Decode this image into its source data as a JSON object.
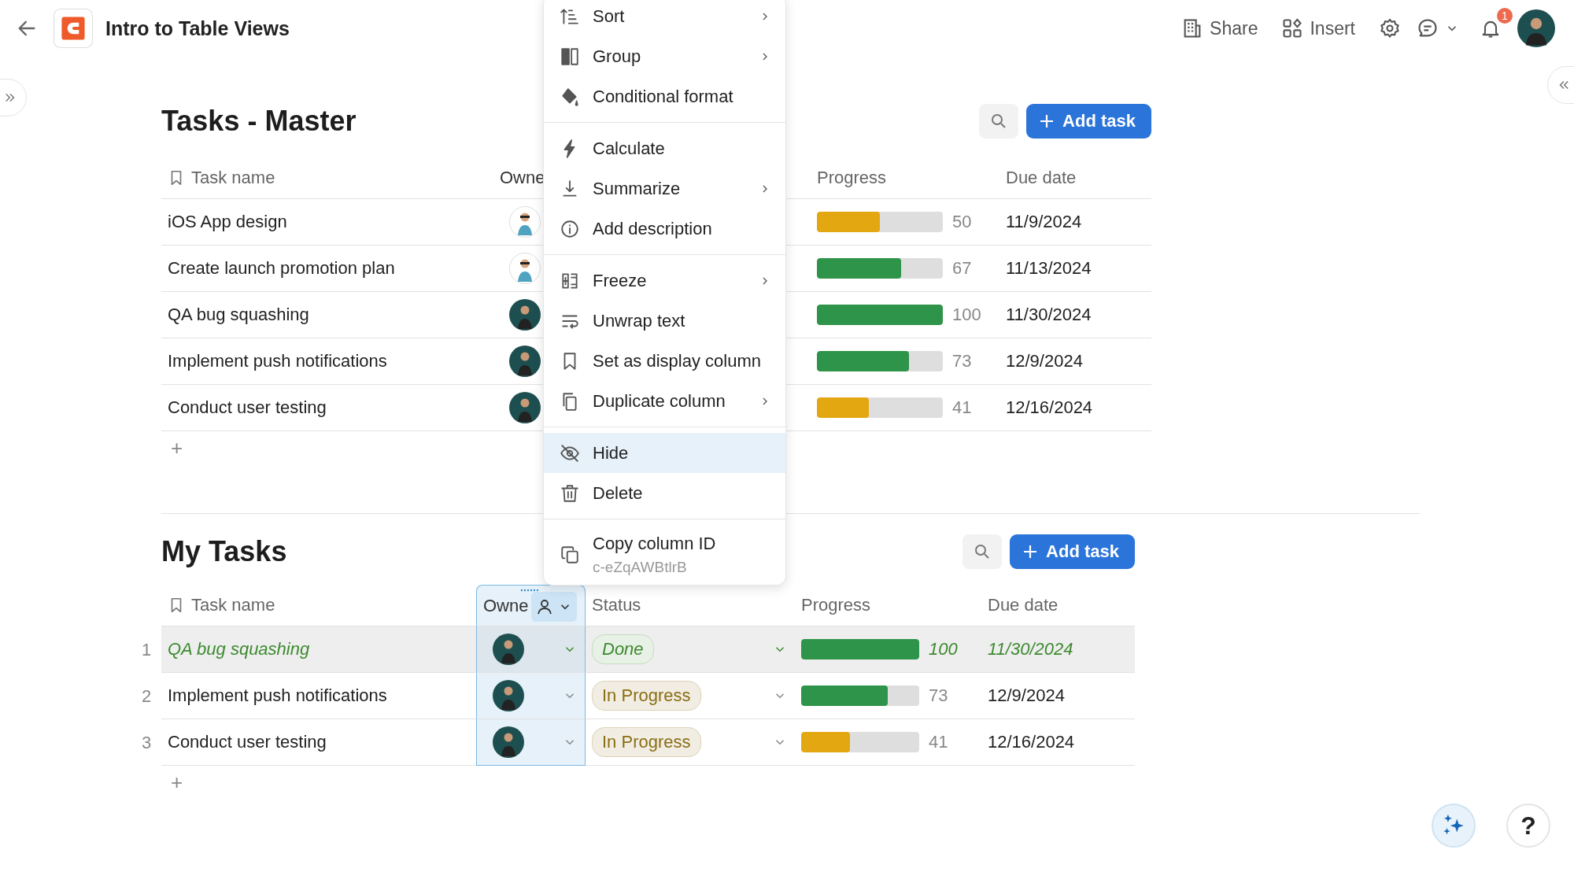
{
  "topbar": {
    "title": "Intro to Table Views",
    "actions": [
      {
        "label": "Share"
      },
      {
        "label": "Insert"
      }
    ],
    "notification_count": "1"
  },
  "tables": [
    {
      "title": "Tasks - Master",
      "add_label": "Add task",
      "columns": [
        {
          "kind": "task",
          "label": "Task name",
          "selected": false
        },
        {
          "kind": "owner",
          "label": "Owne",
          "selected": false
        },
        {
          "kind": "obscured",
          "selected": false
        },
        {
          "kind": "progress",
          "label": "Progress",
          "selected": false
        },
        {
          "kind": "due",
          "label": "Due date",
          "selected": false
        }
      ],
      "rows": [
        {
          "task": "iOS App design",
          "owner": {
            "kind": "light"
          },
          "progress": {
            "level": 0.5,
            "reading": "50",
            "color": "#e3a712"
          },
          "due": "11/9/2024",
          "completed": false,
          "selected": false
        },
        {
          "task": "Create launch promotion plan",
          "owner": {
            "kind": "light"
          },
          "progress": {
            "level": 0.67,
            "reading": "67",
            "color": "#2e9449"
          },
          "due": "11/13/2024",
          "completed": false,
          "selected": false
        },
        {
          "task": "QA bug squashing",
          "owner": {
            "kind": "dark"
          },
          "progress": {
            "level": 1,
            "reading": "100",
            "color": "#2e9449"
          },
          "due": "11/30/2024",
          "completed": false,
          "selected": false
        },
        {
          "task": "Implement push notifications",
          "owner": {
            "kind": "dark"
          },
          "progress": {
            "level": 0.73,
            "reading": "73",
            "color": "#2e9449"
          },
          "due": "12/9/2024",
          "completed": false,
          "selected": false
        },
        {
          "task": "Conduct user testing",
          "owner": {
            "kind": "dark"
          },
          "progress": {
            "level": 0.41,
            "reading": "41",
            "color": "#e3a712"
          },
          "due": "12/16/2024",
          "completed": false,
          "selected": false
        }
      ],
      "add_row": "+"
    },
    {
      "title": "My Tasks",
      "add_label": "Add task",
      "columns": [
        {
          "kind": "task",
          "label": "Task name",
          "selected": false
        },
        {
          "kind": "owner",
          "label": "Owne",
          "selected": true,
          "dropdown": true
        },
        {
          "kind": "status",
          "label": "Status",
          "selected": false
        },
        {
          "kind": "progress",
          "label": "Progress",
          "selected": false
        },
        {
          "kind": "due",
          "label": "Due date",
          "selected": false
        }
      ],
      "rows": [
        {
          "number": "1",
          "task": "QA bug squashing",
          "owner": {
            "kind": "dark"
          },
          "status": {
            "label": "Done",
            "color": "#3c8a2e"
          },
          "progress": {
            "level": 1,
            "reading": "100",
            "color": "#2e9449"
          },
          "due": "11/30/2024",
          "completed": true,
          "selected": true
        },
        {
          "number": "2",
          "task": "Implement push notifications",
          "owner": {
            "kind": "dark"
          },
          "status": {
            "label": "In Progress",
            "color": "#8a6d12"
          },
          "progress": {
            "level": 0.73,
            "reading": "73",
            "color": "#2e9449"
          },
          "due": "12/9/2024",
          "completed": false,
          "selected": false
        },
        {
          "number": "3",
          "task": "Conduct user testing",
          "owner": {
            "kind": "dark"
          },
          "status": {
            "label": "In Progress",
            "color": "#8a6d12"
          },
          "progress": {
            "level": 0.41,
            "reading": "41",
            "color": "#e3a712"
          },
          "due": "12/16/2024",
          "completed": false,
          "selected": false
        }
      ],
      "add_row": "+"
    }
  ],
  "menu": {
    "groups": [
      [
        {
          "label": "Sort",
          "submenu": true,
          "highlighted": false
        },
        {
          "label": "Group",
          "submenu": true,
          "highlighted": false
        },
        {
          "label": "Conditional format",
          "submenu": false,
          "highlighted": false
        }
      ],
      [
        {
          "label": "Calculate",
          "submenu": false,
          "highlighted": false
        },
        {
          "label": "Summarize",
          "submenu": true,
          "highlighted": false
        },
        {
          "label": "Add description",
          "submenu": false,
          "highlighted": false
        }
      ],
      [
        {
          "label": "Freeze",
          "submenu": true,
          "highlighted": false
        },
        {
          "label": "Unwrap text",
          "submenu": false,
          "highlighted": false
        },
        {
          "label": "Set as display column",
          "submenu": false,
          "highlighted": false
        },
        {
          "label": "Duplicate column",
          "submenu": true,
          "highlighted": false
        }
      ],
      [
        {
          "label": "Hide",
          "submenu": false,
          "highlighted": true
        },
        {
          "label": "Delete",
          "submenu": false,
          "highlighted": false
        }
      ],
      [
        {
          "label": "Copy column ID",
          "sublabel": "c-eZqAWBtlrB",
          "submenu": false,
          "highlighted": false
        }
      ]
    ]
  },
  "help_label": "?"
}
